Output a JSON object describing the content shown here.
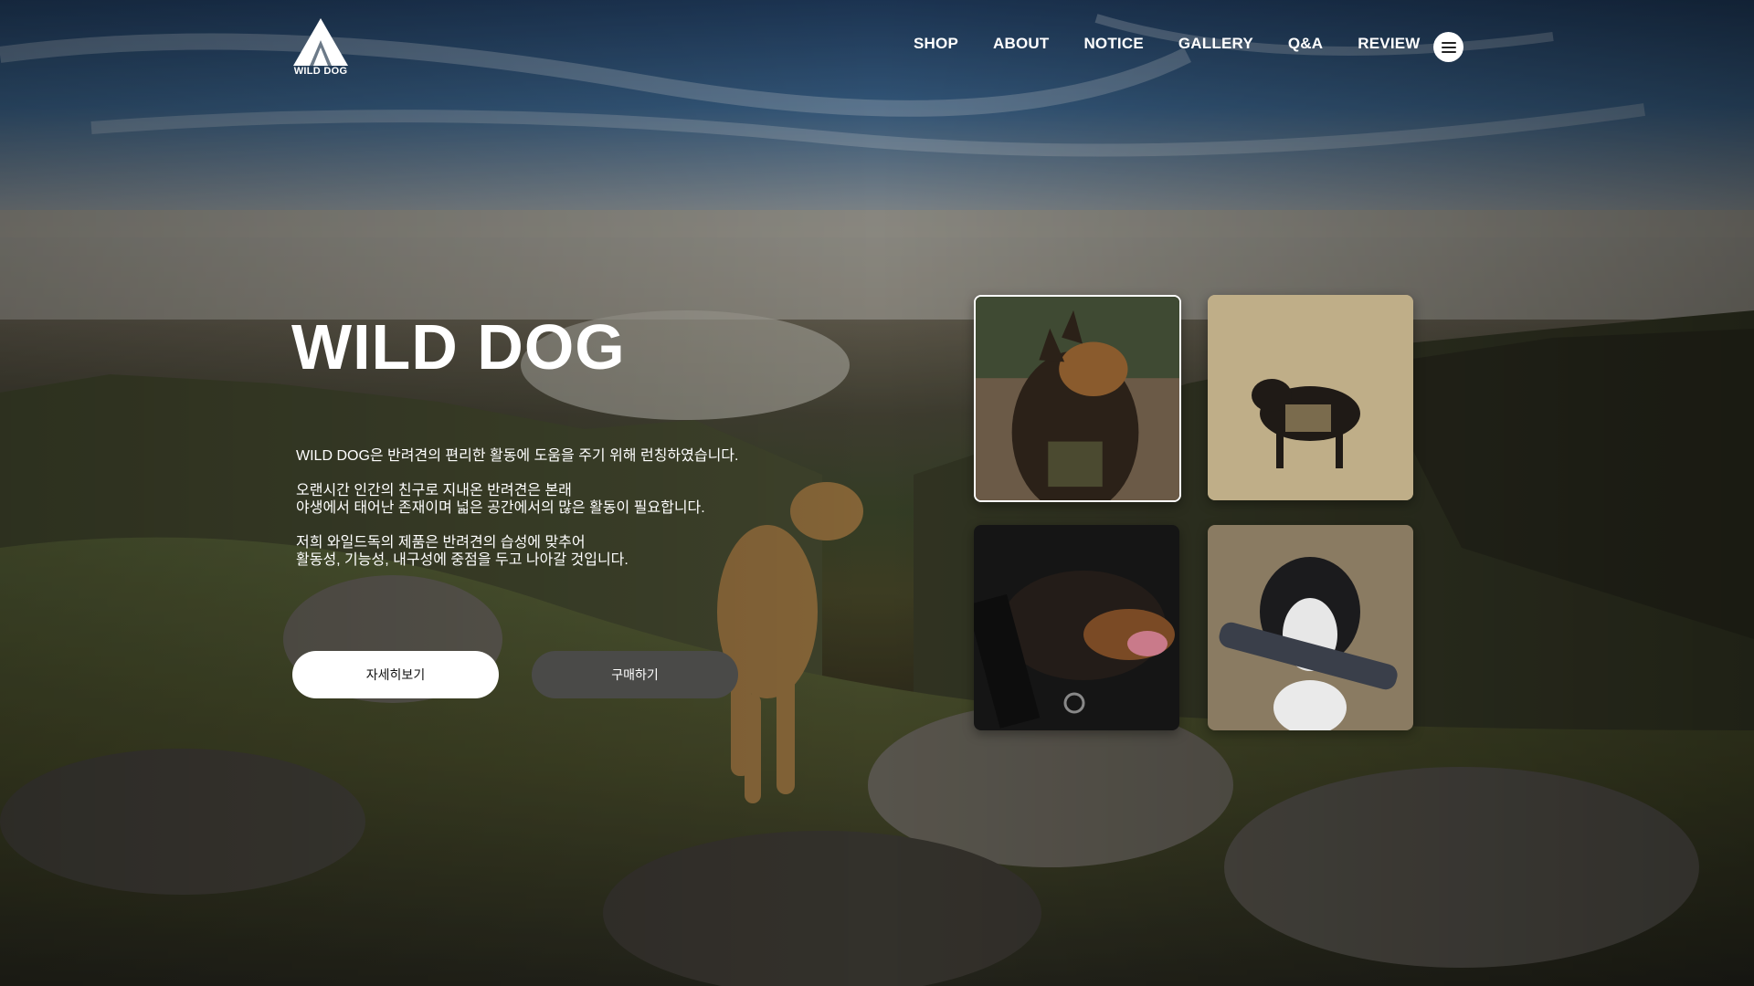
{
  "brand": {
    "name": "WILD DOG",
    "logo_icon": "mountain-logo-icon"
  },
  "nav": {
    "items": [
      {
        "label": "SHOP"
      },
      {
        "label": "ABOUT"
      },
      {
        "label": "NOTICE"
      },
      {
        "label": "GALLERY"
      },
      {
        "label": "Q&A"
      },
      {
        "label": "REVIEW"
      }
    ],
    "menu_icon": "hamburger-menu-icon"
  },
  "hero": {
    "title": "WILD DOG",
    "paragraphs": [
      [
        "WILD DOG은 반려견의 편리한 활동에  도움을 주기 위해 런칭하였습니다."
      ],
      [
        "오랜시간 인간의 친구로 지내온 반려견은 본래",
        "야생에서 태어난 존재이며  넓은 공간에서의 많은 활동이 필요합니다."
      ],
      [
        "저희 와일드독의 제품은 반려견의 습성에 맞추어",
        "활동성, 기능성, 내구성에 중점을 두고 나아갈 것입니다."
      ]
    ],
    "buttons": {
      "detail": "자세히보기",
      "buy": "구매하기"
    }
  },
  "gallery": [
    {
      "subject": "german-shepherd-collar-photo"
    },
    {
      "subject": "pinscher-harness-photo"
    },
    {
      "subject": "doberman-security-collar-photo"
    },
    {
      "subject": "border-collie-tug-toy-photo"
    }
  ],
  "colors": {
    "text": "#ffffff",
    "button_primary_bg": "#ffffff",
    "button_secondary_bg": "#4a4a48"
  }
}
